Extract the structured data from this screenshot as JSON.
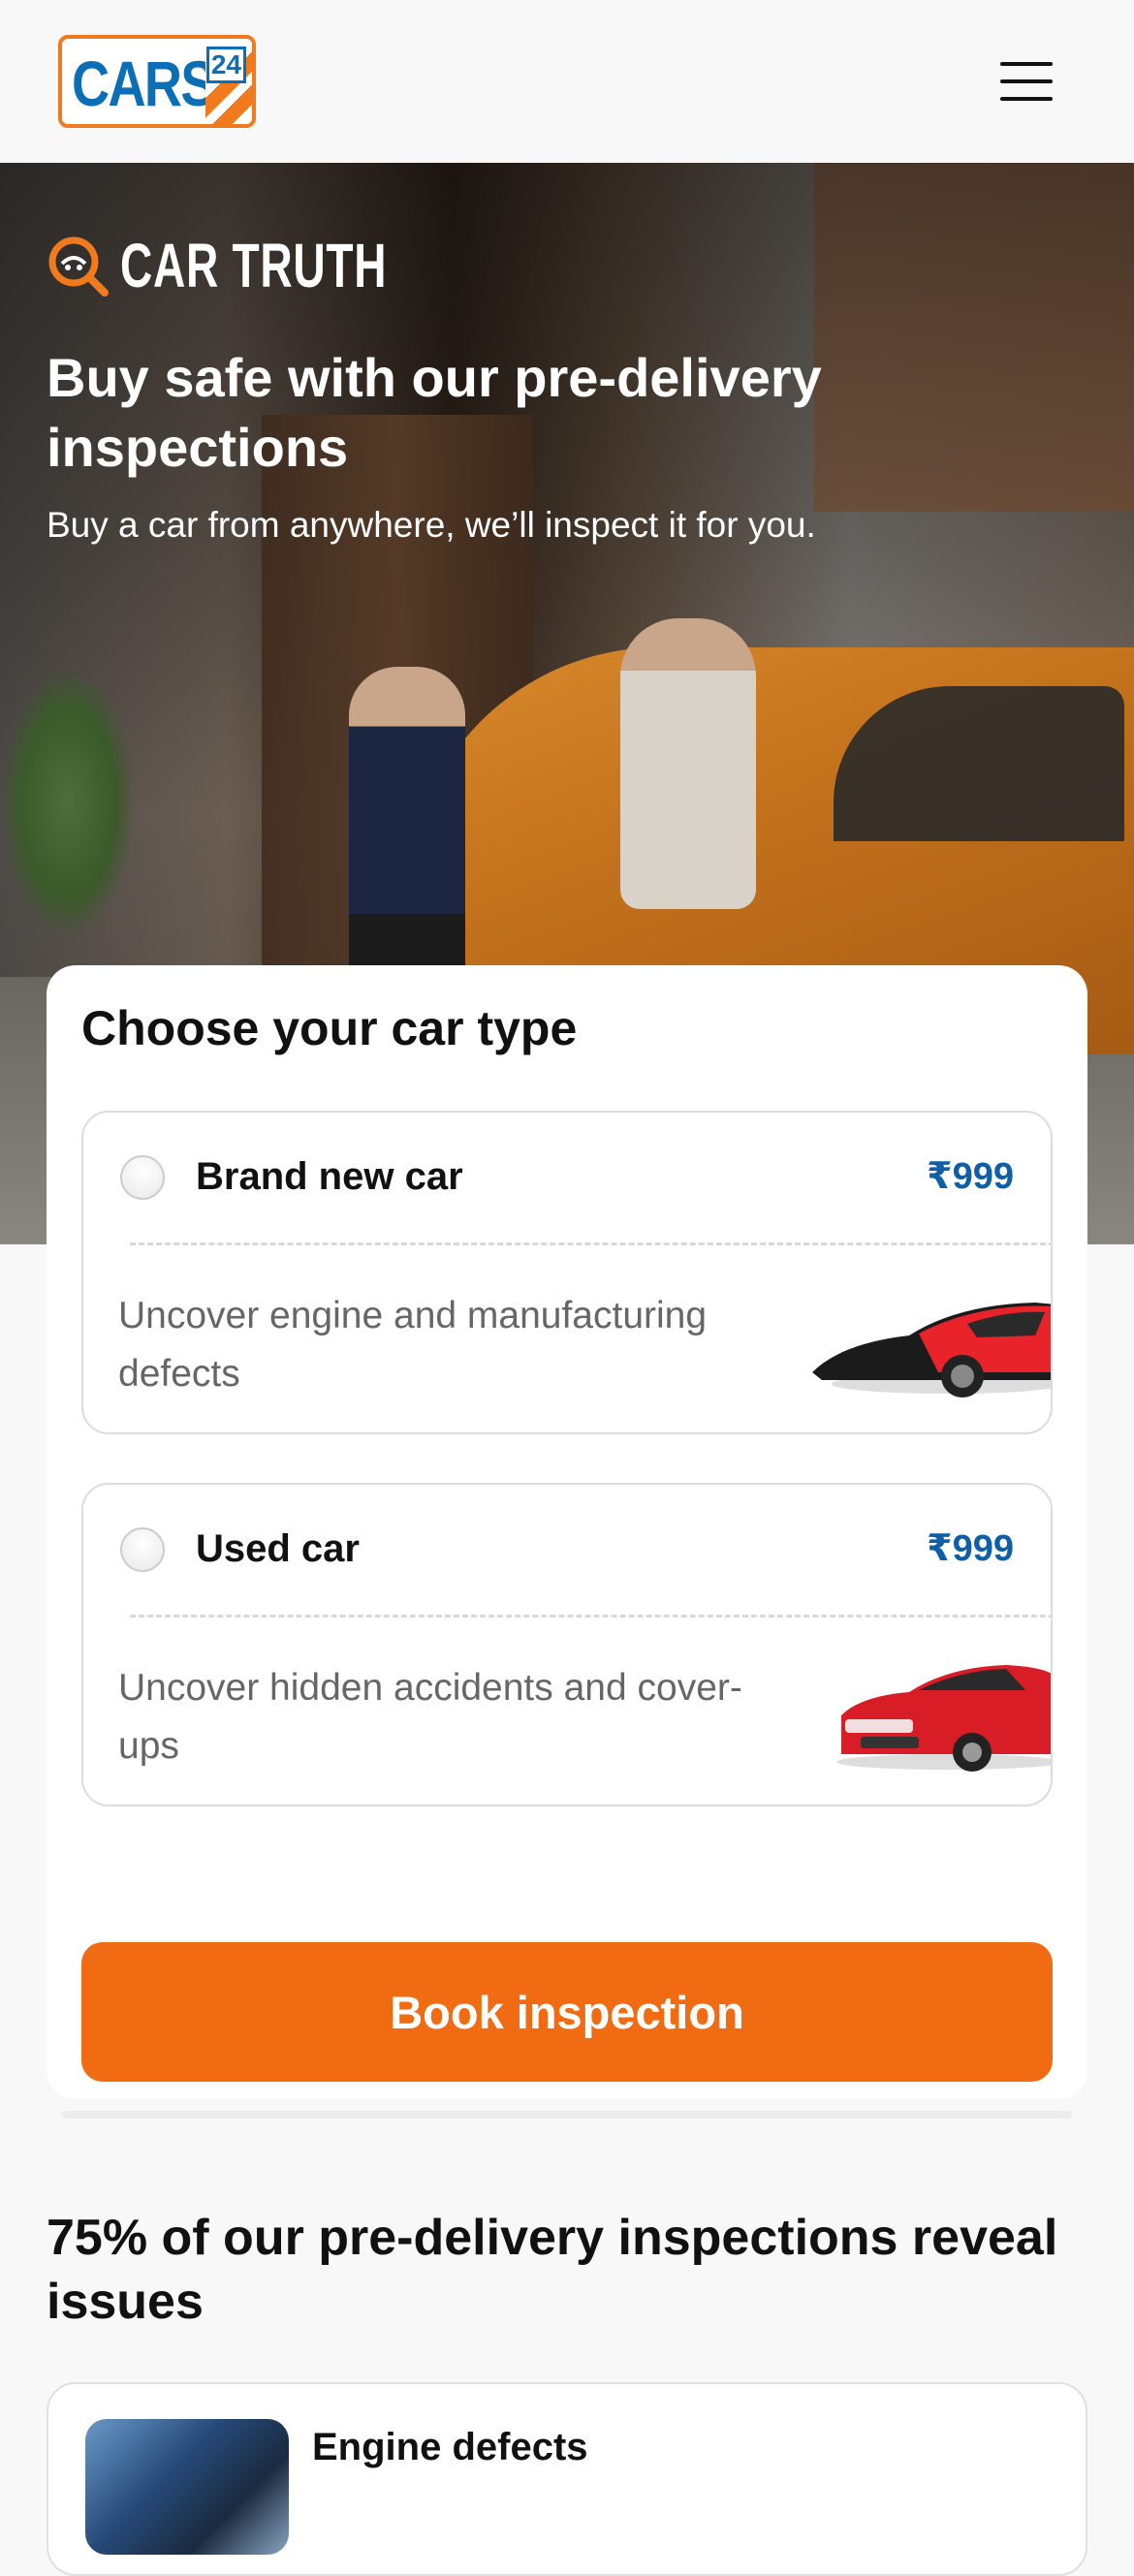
{
  "header": {
    "logo_text": "CARS",
    "logo_number": "24",
    "menu_icon": "hamburger-menu-icon"
  },
  "hero": {
    "brand": "CAR TRUTH",
    "brand_icon": "magnifier-car-icon",
    "title": "Buy safe with our pre-delivery inspections",
    "subtitle": "Buy a car from anywhere, we’ll inspect it for you."
  },
  "car_type": {
    "heading": "Choose your car type",
    "options": [
      {
        "name": "Brand new car",
        "price": "₹999",
        "description": "Uncover engine and manufacturing defects",
        "selected": false,
        "image_icon": "black-red-car-icon"
      },
      {
        "name": "Used car",
        "price": "₹999",
        "description": "Uncover hidden accidents and cover-ups",
        "selected": false,
        "image_icon": "red-sedan-icon"
      }
    ],
    "cta": "Book inspection"
  },
  "stats": {
    "heading": "75% of our pre-delivery inspections reveal issues",
    "items": [
      {
        "title": "Engine defects"
      }
    ]
  },
  "colors": {
    "accent_orange": "#f06b12",
    "price_blue": "#0f5ea8",
    "logo_blue": "#0c6fb5"
  }
}
